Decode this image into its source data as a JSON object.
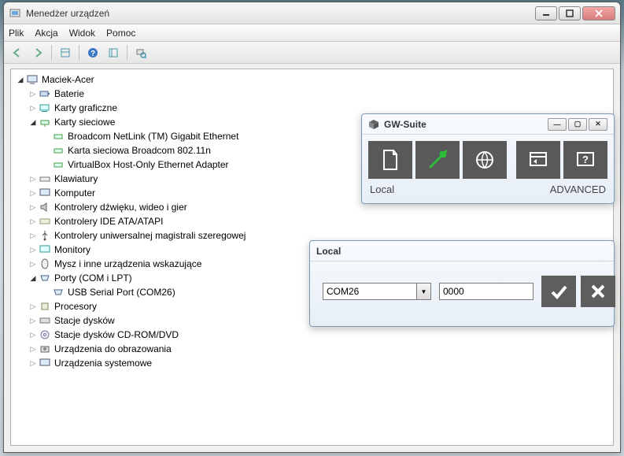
{
  "window": {
    "title": "Menedżer urządzeń"
  },
  "menu": {
    "file": "Plik",
    "action": "Akcja",
    "view": "Widok",
    "help": "Pomoc"
  },
  "tree": {
    "root": "Maciek-Acer",
    "batteries": "Baterie",
    "gpu": "Karty graficzne",
    "net": "Karty sieciowe",
    "net_items": {
      "a": "Broadcom NetLink (TM) Gigabit Ethernet",
      "b": "Karta sieciowa Broadcom 802.11n",
      "c": "VirtualBox Host-Only Ethernet Adapter"
    },
    "keyboards": "Klawiatury",
    "computer": "Komputer",
    "sound": "Kontrolery dźwięku, wideo i gier",
    "ide": "Kontrolery IDE ATA/ATAPI",
    "usb": "Kontrolery uniwersalnej magistrali szeregowej",
    "monitors": "Monitory",
    "mouse": "Mysz i inne urządzenia wskazujące",
    "ports": "Porty (COM i LPT)",
    "ports_items": {
      "a": "USB Serial Port (COM26)"
    },
    "cpu": "Procesory",
    "disks": "Stacje dysków",
    "cdrom": "Stacje dysków CD-ROM/DVD",
    "imaging": "Urządzenia do obrazowania",
    "system": "Urządzenia systemowe"
  },
  "gw": {
    "title": "GW-Suite",
    "local": "Local",
    "advanced": "ADVANCED"
  },
  "local_panel": {
    "title": "Local",
    "combo_value": "COM26",
    "text_value": "0000"
  }
}
